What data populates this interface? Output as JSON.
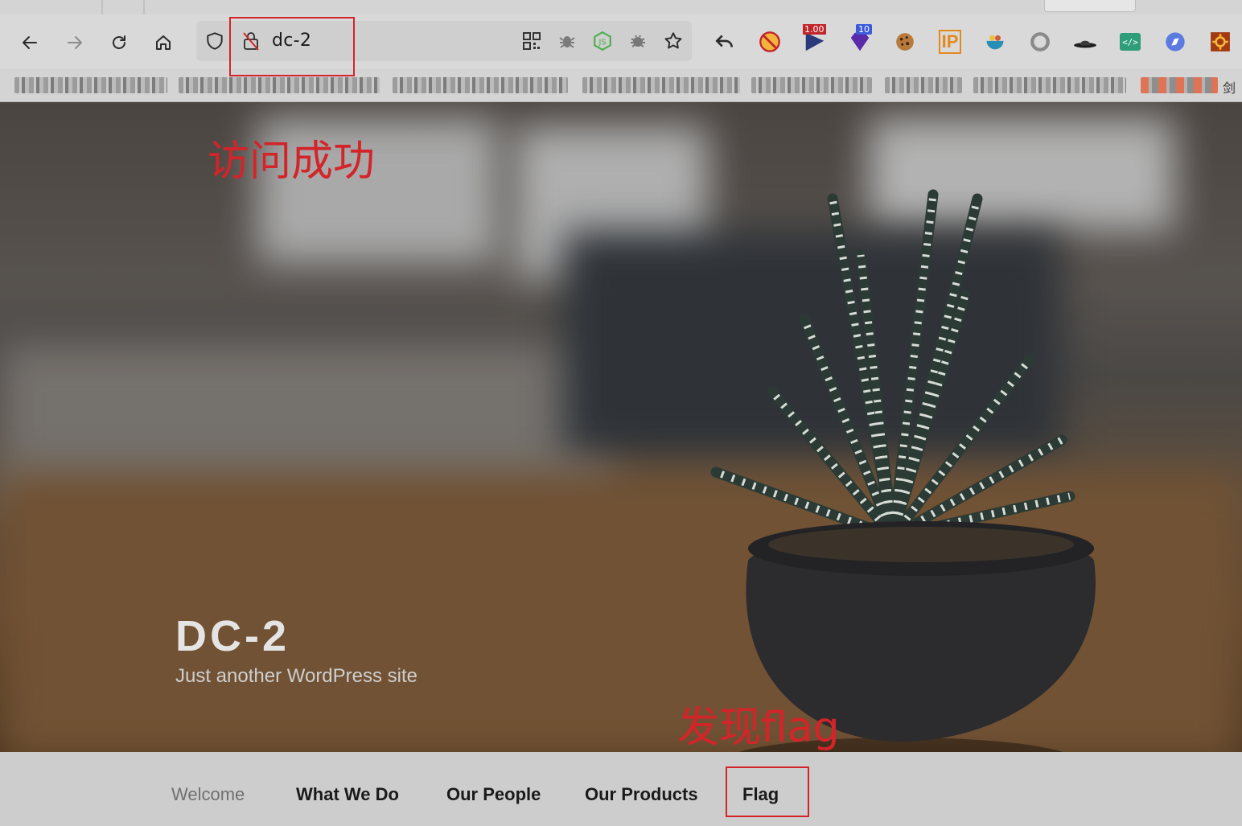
{
  "browser": {
    "address": "dc-2",
    "nav_icons": [
      "back-arrow-icon",
      "forward-arrow-icon",
      "reload-icon",
      "home-icon"
    ],
    "url_icons": [
      "shield-icon",
      "insecure-lock-icon"
    ],
    "url_actions": [
      "qr-code-icon",
      "bug-icon",
      "nodejs-icon",
      "debug-icon",
      "star-icon"
    ],
    "extensions": [
      {
        "name": "undo-extension-icon"
      },
      {
        "name": "no-script-extension-icon"
      },
      {
        "name": "flag-extension-icon",
        "badge": "1.00"
      },
      {
        "name": "gem-extension-icon",
        "badge": "10"
      },
      {
        "name": "cookie-extension-icon"
      },
      {
        "name": "ip-extension-icon",
        "label": "IP"
      },
      {
        "name": "bowl-extension-icon"
      },
      {
        "name": "circle-extension-icon"
      },
      {
        "name": "hat-extension-icon"
      },
      {
        "name": "code-extension-icon",
        "label": "</>"
      },
      {
        "name": "compass-extension-icon"
      },
      {
        "name": "gear-extension-icon"
      }
    ],
    "bookmarks_tail": "剑"
  },
  "annotations": {
    "access": "访问成功",
    "found_flag": "发现flag"
  },
  "site": {
    "title": "DC-2",
    "tagline": "Just another WordPress site"
  },
  "menu": {
    "items": [
      {
        "label": "Welcome",
        "active": true
      },
      {
        "label": "What We Do",
        "active": false
      },
      {
        "label": "Our People",
        "active": false
      },
      {
        "label": "Our Products",
        "active": false
      },
      {
        "label": "Flag",
        "active": false
      }
    ]
  },
  "colors": {
    "annotation_red": "#d3242a",
    "menu_bg": "#cdcdcd",
    "chrome_bg": "#d9d9d9"
  }
}
